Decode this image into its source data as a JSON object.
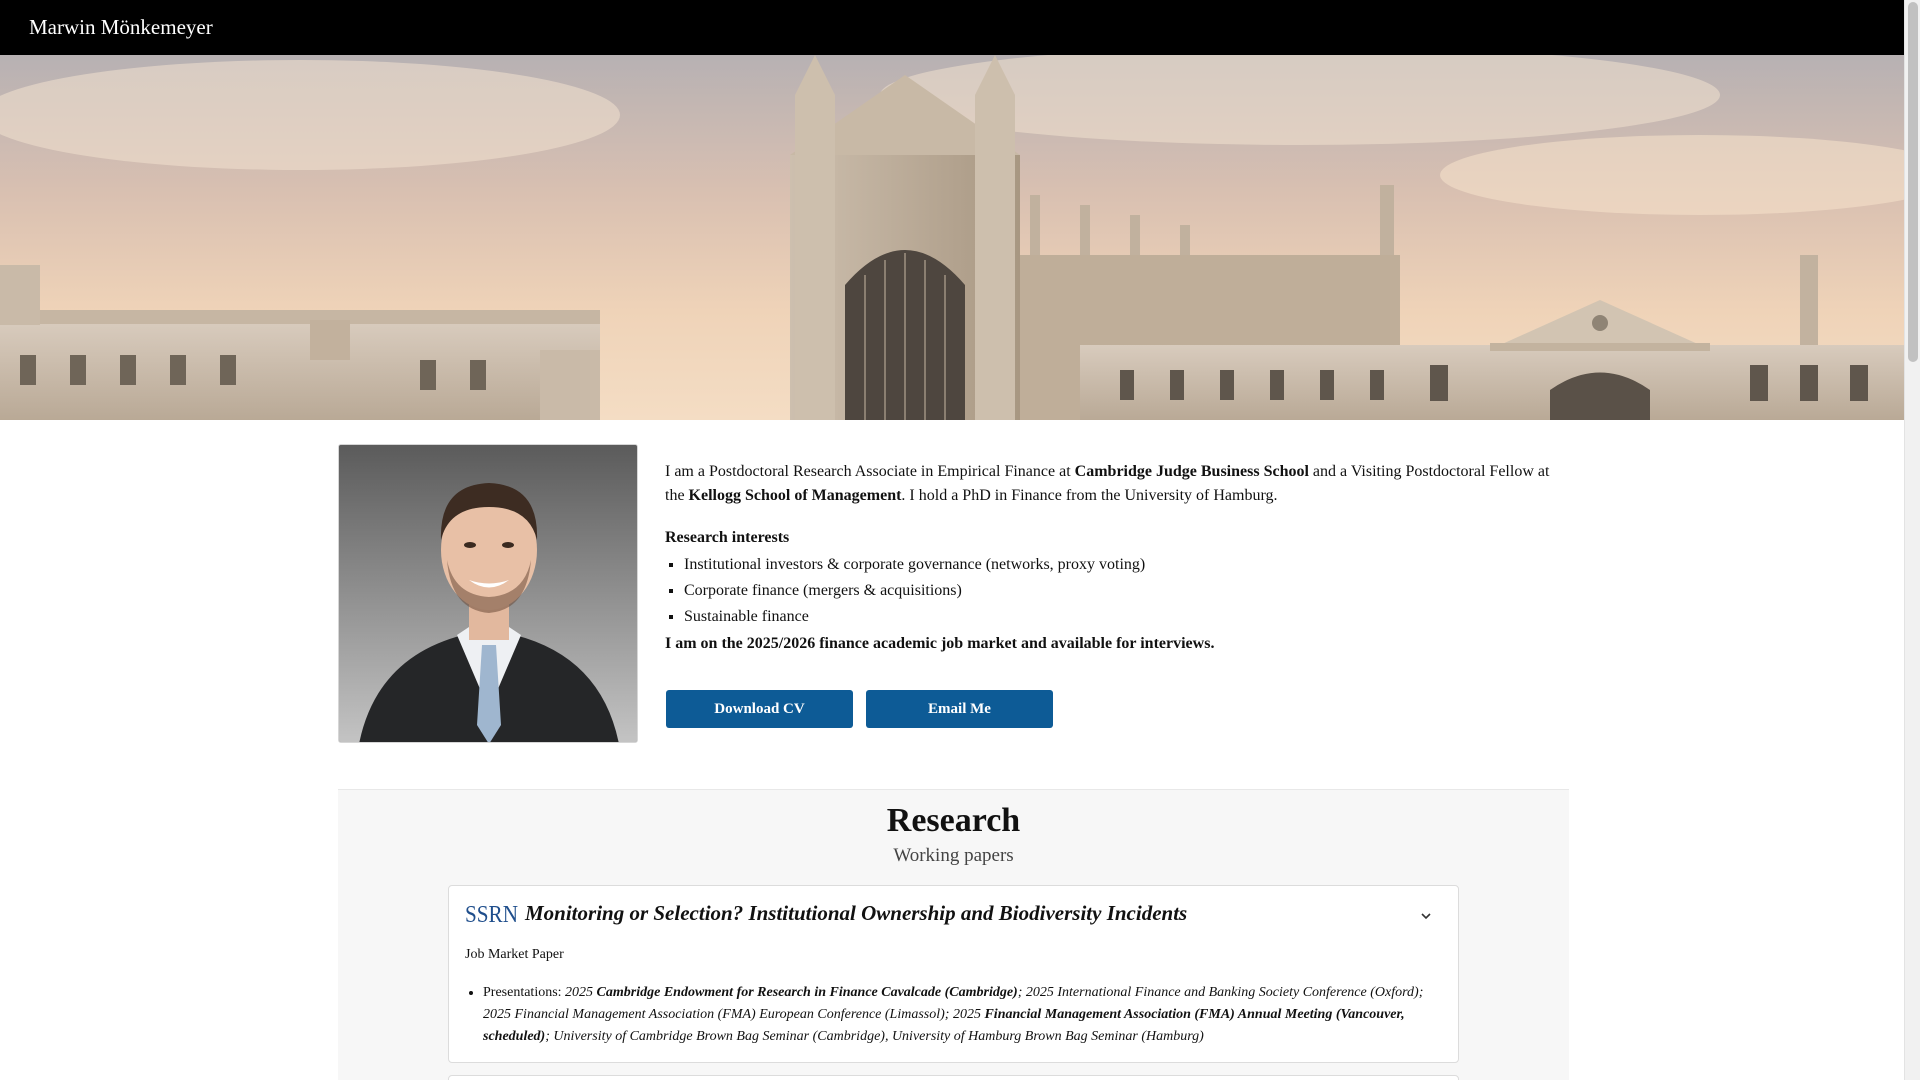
{
  "navbar": {
    "brand": "Marwin Mönkemeyer"
  },
  "hero": {
    "image": "Cambridge King's College chapel banner"
  },
  "profile": {
    "photo": "portrait-photo"
  },
  "bio": {
    "intro_1": "I am a Postdoctoral Research Associate in Empirical Finance at ",
    "school_1": "Cambridge Judge Business School",
    "intro_2": " and a Visiting Postdoctoral Fellow at the ",
    "school_2": "Kellogg School of Management",
    "intro_3": ". I hold a PhD in Finance from the University of Hamburg.",
    "interests_heading": "Research interests",
    "interests": [
      "Institutional investors & corporate governance (networks, proxy voting)",
      "Corporate finance (mergers & acquisitions)",
      "Sustainable finance"
    ],
    "job_market": "I am on the 2025/2026 finance academic job market and available for interviews."
  },
  "buttons": {
    "cv": "Download CV",
    "email": "Email Me"
  },
  "research": {
    "title": "Research",
    "subtitle": "Working papers",
    "papers": [
      {
        "logo": "SSRN",
        "title": "Monitoring or Selection? Institutional Ownership and Biodiversity Incidents",
        "tag": "Job Market Paper",
        "presentations_label": "Presentations: ",
        "p1": "2025 ",
        "p1_bold": "Cambridge Endowment for Research in Finance Cavalcade (Cambridge)",
        "p2": "; 2025 International Finance and Banking Society Conference (Oxford); 2025 Financial Management Association (FMA) European Conference (Limassol); 2025 ",
        "p2_bold": "Financial Management Association (FMA) Annual Meeting (Vancouver, scheduled)",
        "p3": "; University of Cambridge Brown Bag Seminar (Cambridge), University of Hamburg Brown Bag Seminar (Hamburg)"
      }
    ]
  },
  "colors": {
    "navbar": "#000000",
    "button": "#0d5b96",
    "ssrn": "#1f4e8c"
  }
}
